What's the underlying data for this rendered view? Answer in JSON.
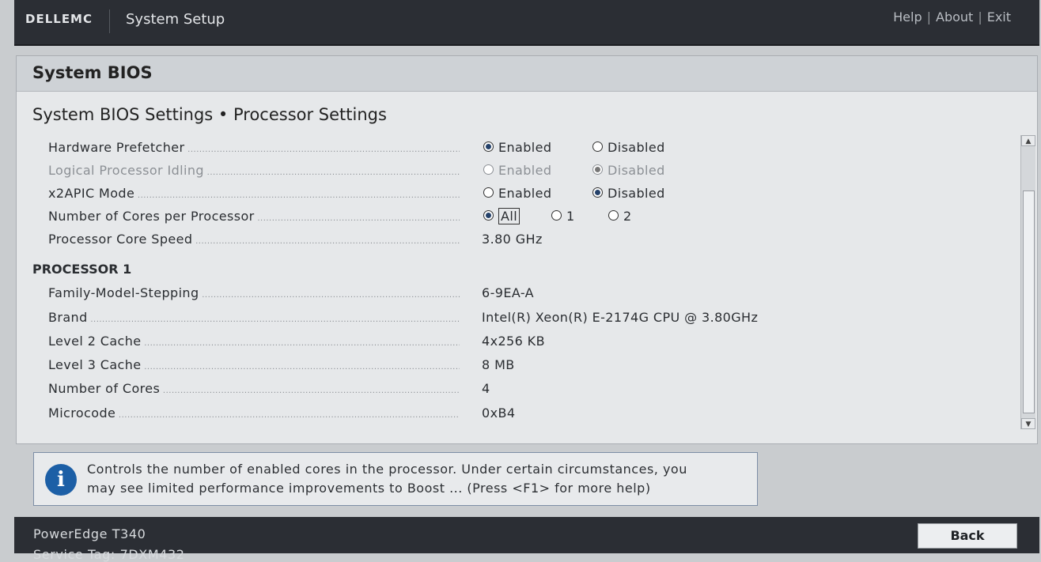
{
  "header": {
    "brand": "DELLEMC",
    "app_title": "System Setup",
    "links": [
      "Help",
      "About",
      "Exit"
    ],
    "separator": "|"
  },
  "panel": {
    "title": "System BIOS",
    "breadcrumb": "System BIOS Settings • Processor Settings"
  },
  "settings": {
    "hw_prefetcher": {
      "label": "Hardware Prefetcher",
      "opt1": "Enabled",
      "opt2": "Disabled",
      "selected": "Enabled"
    },
    "logical_idling": {
      "label": "Logical Processor Idling",
      "opt1": "Enabled",
      "opt2": "Disabled",
      "selected": "Disabled",
      "disabled": true
    },
    "x2apic": {
      "label": "x2APIC Mode",
      "opt1": "Enabled",
      "opt2": "Disabled",
      "selected": "Disabled"
    },
    "cores_per_proc": {
      "label": "Number of Cores per Processor",
      "opt1": "All",
      "opt2": "1",
      "opt3": "2",
      "selected": "All"
    },
    "core_speed": {
      "label": "Processor Core Speed",
      "value": "3.80 GHz"
    }
  },
  "processor": {
    "heading": "PROCESSOR 1",
    "family": {
      "label": "Family-Model-Stepping",
      "value": "6-9EA-A"
    },
    "brand": {
      "label": "Brand",
      "value": "Intel(R) Xeon(R) E-2174G CPU @ 3.80GHz"
    },
    "l2": {
      "label": "Level 2 Cache",
      "value": "4x256 KB"
    },
    "l3": {
      "label": "Level 3 Cache",
      "value": "8 MB"
    },
    "cores": {
      "label": "Number of Cores",
      "value": "4"
    },
    "microcode": {
      "label": "Microcode",
      "value": "0xB4"
    }
  },
  "help": {
    "icon": "i",
    "line1": "Controls the number of enabled cores in the processor. Under certain circumstances, you",
    "line2": "may see limited performance improvements to Boost ... (Press <F1> for more help)"
  },
  "footer": {
    "model": "PowerEdge T340",
    "service_tag": "Service Tag: 7DXM432",
    "back_label": "Back"
  },
  "colors": {
    "bar_bg": "#2b2e34",
    "panel_bg": "#e6e8ea",
    "info_blue": "#1c5fa6",
    "radio_fill": "#24416a"
  }
}
